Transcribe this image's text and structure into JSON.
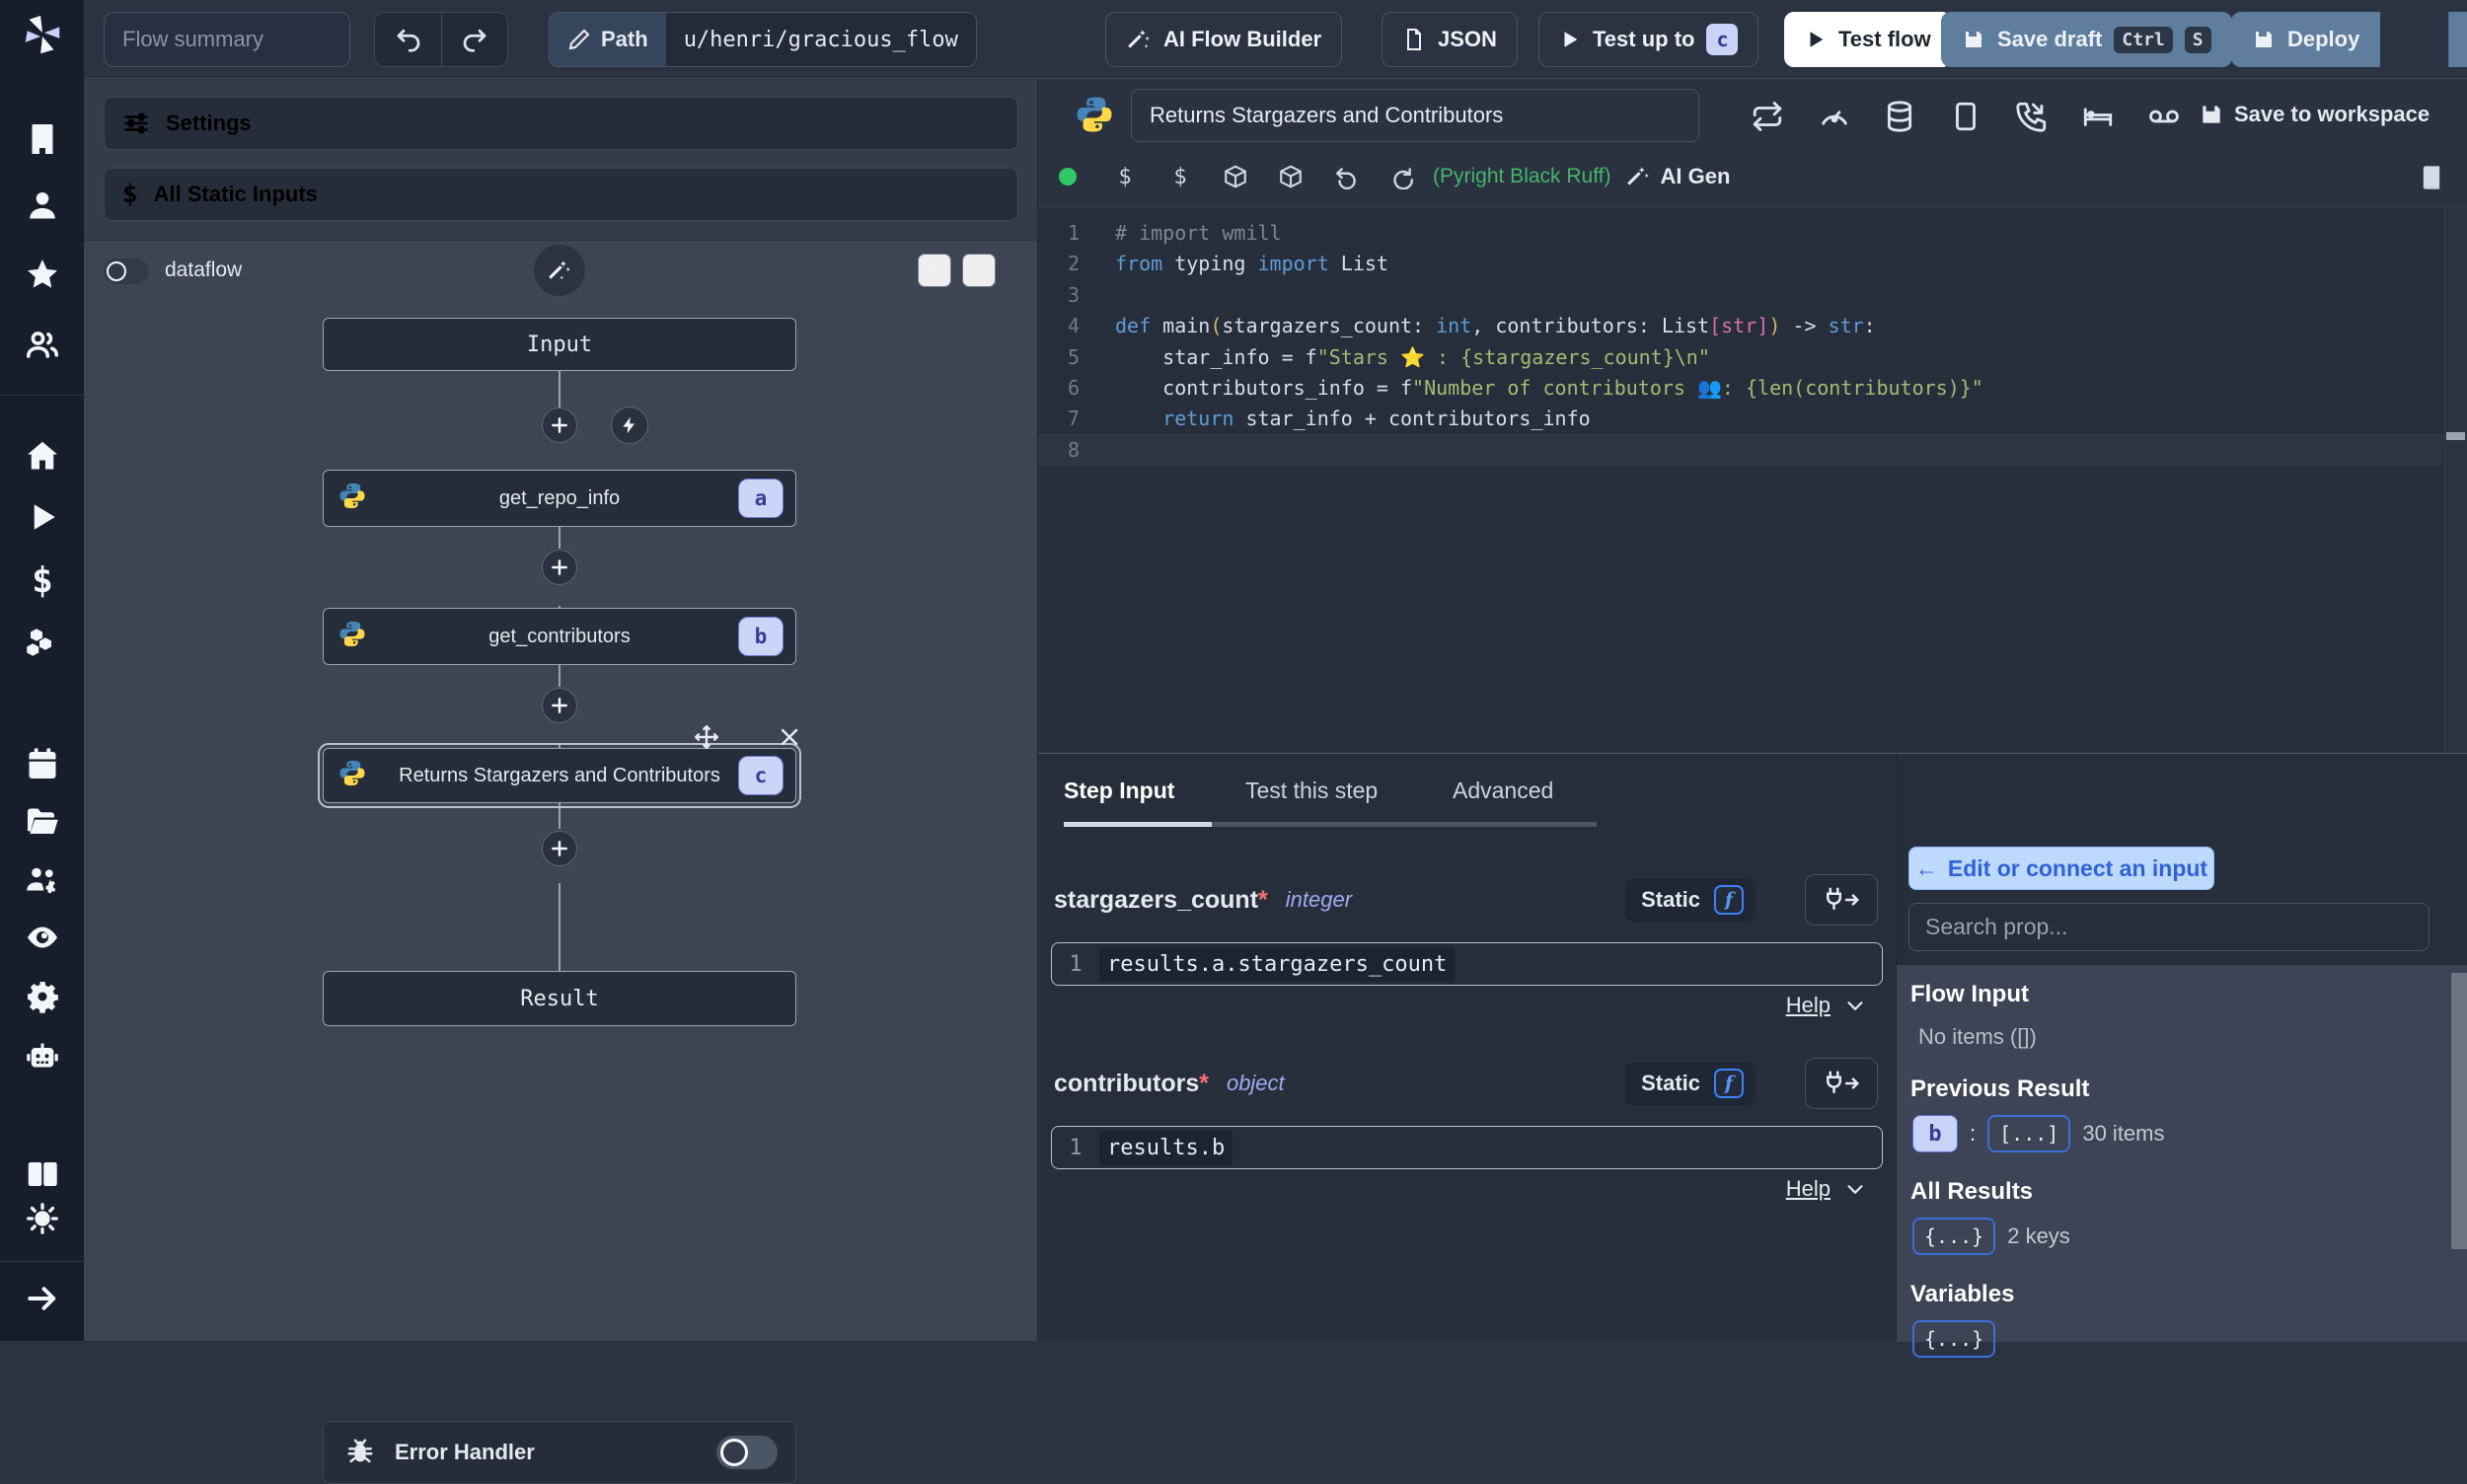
{
  "topbar": {
    "flow_summary_placeholder": "Flow summary",
    "path_label": "Path",
    "path_value": "u/henri/gracious_flow",
    "ai_flow_builder": "AI Flow Builder",
    "json_label": "JSON",
    "test_up_to": "Test up to",
    "test_up_to_badge": "c",
    "test_flow": "Test flow",
    "save_draft": "Save draft",
    "save_draft_kbd_ctrl": "Ctrl",
    "save_draft_kbd_s": "S",
    "deploy": "Deploy"
  },
  "flow_panel": {
    "settings_label": "Settings",
    "static_inputs_label": "All Static Inputs",
    "dataflow_label": "dataflow",
    "input_node": "Input",
    "result_node": "Result",
    "error_handler": "Error Handler",
    "steps": [
      {
        "label": "get_repo_info",
        "badge": "a"
      },
      {
        "label": "get_contributors",
        "badge": "b"
      },
      {
        "label": "Returns Stargazers and Contributors",
        "badge": "c"
      }
    ]
  },
  "script_panel": {
    "title_value": "Returns Stargazers and Contributors",
    "save_to_workspace": "Save to workspace",
    "lang_assistants": "(Pyright Black Ruff)",
    "ai_gen": "AI Gen"
  },
  "editor": {
    "lines": [
      [
        [
          "cm",
          "# import wmill"
        ]
      ],
      [
        [
          "kw",
          "from"
        ],
        [
          "tx",
          " typing "
        ],
        [
          "kw",
          "import"
        ],
        [
          "tx",
          " List"
        ]
      ],
      [],
      [
        [
          "kw",
          "def"
        ],
        [
          "tx",
          " main"
        ],
        [
          "py",
          "("
        ],
        [
          "tx",
          "stargazers_count: "
        ],
        [
          "kw",
          "int"
        ],
        [
          "tx",
          ", contributors: List"
        ],
        [
          "pk",
          "[str]"
        ],
        [
          "py",
          ")"
        ],
        [
          "tx",
          " -> "
        ],
        [
          "kw",
          "str"
        ],
        [
          "tx",
          ":"
        ]
      ],
      [
        [
          "tx",
          "    star_info = f"
        ],
        [
          "st",
          "\"Stars "
        ],
        [
          "em",
          "⭐"
        ],
        [
          "st",
          " : {stargazers_count}\\n\""
        ]
      ],
      [
        [
          "tx",
          "    contributors_info = f"
        ],
        [
          "st",
          "\"Number of contributors "
        ],
        [
          "em",
          "👥"
        ],
        [
          "st",
          ": {len(contributors)}\""
        ]
      ],
      [
        [
          "tx",
          "    "
        ],
        [
          "kw",
          "return"
        ],
        [
          "tx",
          " star_info + contributors_info"
        ]
      ],
      []
    ]
  },
  "step_panel": {
    "tabs": [
      "Step Input",
      "Test this step",
      "Advanced"
    ],
    "fields": [
      {
        "name": "stargazers_count",
        "required": "*",
        "type": "integer",
        "static_label": "Static",
        "line_no": "1",
        "expr": "results.a.stargazers_count",
        "help": "Help"
      },
      {
        "name": "contributors",
        "required": "*",
        "type": "object",
        "static_label": "Static",
        "line_no": "1",
        "expr": "results.b",
        "help": "Help"
      }
    ]
  },
  "props_panel": {
    "edit_connect_arrow": "←",
    "edit_connect": "Edit or connect an input",
    "search_placeholder": "Search prop...",
    "flow_input_title": "Flow Input",
    "flow_input_empty": "No items ([])",
    "previous_result_title": "Previous Result",
    "previous_result_badge": "b",
    "previous_result_colon": ":",
    "previous_result_array": "[...]",
    "previous_result_count": "30 items",
    "all_results_title": "All Results",
    "all_results_badge": "{...}",
    "all_results_count": "2 keys",
    "variables_title": "Variables",
    "variables_badge": "{...}"
  },
  "colors": {
    "accent_blue": "#3b82f6",
    "steel_button": "#5f7d9c",
    "badge_lavender": "#c9d3f8",
    "success_green": "#46b567"
  }
}
